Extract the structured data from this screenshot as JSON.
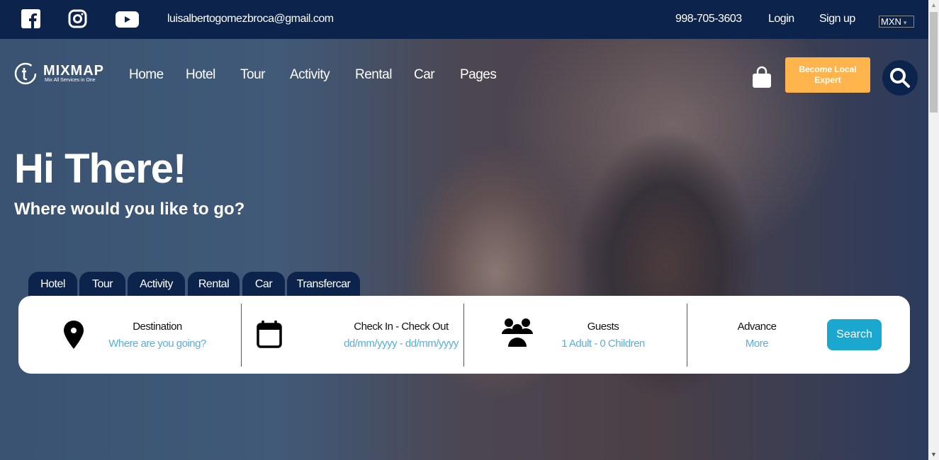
{
  "topbar": {
    "email": "luisalbertogomezbroca@gmail.com",
    "phone": "998-705-3603",
    "login": "Login",
    "signup": "Sign up",
    "currency": "MXN",
    "social": [
      "facebook-icon",
      "instagram-icon",
      "youtube-icon"
    ]
  },
  "logo": {
    "name": "MIXMAP",
    "tagline": "Mix All Services in One"
  },
  "nav": [
    "Home",
    "Hotel",
    "Tour",
    "Activity",
    "Rental",
    "Car",
    "Pages"
  ],
  "become_expert": "Become Local Expert",
  "hero": {
    "title": "Hi There!",
    "subtitle": "Where would you like to go?"
  },
  "tabs": [
    "Hotel",
    "Tour",
    "Activity",
    "Rental",
    "Car",
    "Transfercar"
  ],
  "search": {
    "destination": {
      "label": "Destination",
      "value": "Where are you going?"
    },
    "dates": {
      "label": "Check In - Check Out",
      "value": "dd/mm/yyyy - dd/mm/yyyy"
    },
    "guests": {
      "label": "Guests",
      "value": "1 Adult - 0 Children"
    },
    "advance": {
      "label": "Advance",
      "value": "More"
    },
    "button": "Search"
  },
  "colors": {
    "navy": "#0c234b",
    "accent": "#ffb54c",
    "search": "#1ba8d0",
    "link": "#5aaed8"
  }
}
